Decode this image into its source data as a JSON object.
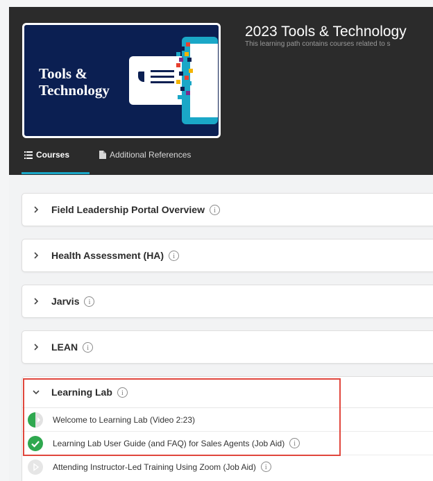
{
  "header": {
    "thumbnail_title_line1": "Tools &",
    "thumbnail_title_line2": "Technology",
    "title": "2023 Tools & Technology",
    "subtitle": "This learning path contains courses related to s"
  },
  "tabs": [
    {
      "label": "Courses",
      "icon": "list-icon",
      "active": true
    },
    {
      "label": "Additional References",
      "icon": "document-icon",
      "active": false
    }
  ],
  "courses": [
    {
      "label": "Field Leadership Portal Overview",
      "expanded": false
    },
    {
      "label": "Health Assessment (HA)",
      "expanded": false
    },
    {
      "label": "Jarvis",
      "expanded": false
    },
    {
      "label": "LEAN",
      "expanded": false
    },
    {
      "label": "Learning Lab",
      "expanded": true
    }
  ],
  "learning_lab_items": [
    {
      "label": "Welcome to Learning Lab (Video 2:23)",
      "status": "in-progress",
      "info": false
    },
    {
      "label": "Learning Lab User Guide (and FAQ) for Sales Agents (Job Aid)",
      "status": "completed",
      "info": true
    },
    {
      "label": "Attending Instructor-Led Training Using Zoom (Job Aid)",
      "status": "not-started",
      "info": true
    }
  ],
  "info_glyph": "i",
  "colors": {
    "header_bg": "#2b2b2b",
    "accent": "#1aa7c7",
    "thumbnail_bg": "#0b1f52",
    "status_green": "#2fa84f",
    "highlight": "#e0463c"
  }
}
